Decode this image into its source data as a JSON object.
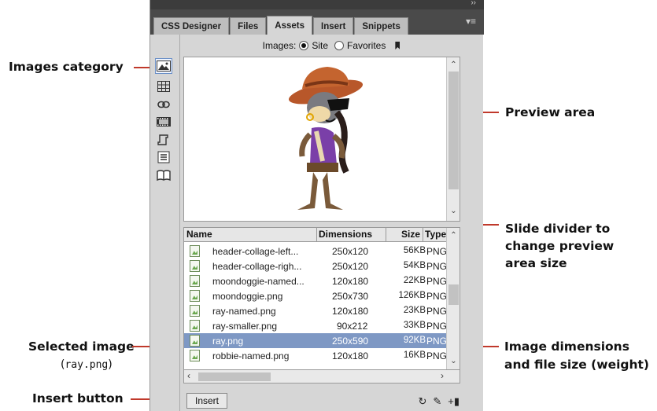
{
  "panel": {
    "tabs": [
      {
        "label": "CSS Designer"
      },
      {
        "label": "Files"
      },
      {
        "label": "Assets"
      },
      {
        "label": "Insert"
      },
      {
        "label": "Snippets"
      }
    ],
    "active_tab": "Assets",
    "filter": {
      "label": "Images:",
      "site_label": "Site",
      "favorites_label": "Favorites",
      "selected": "Site"
    },
    "categories": [
      "images-icon",
      "colors-icon",
      "urls-icon",
      "media-icon",
      "scripts-icon",
      "templates-icon",
      "library-icon"
    ],
    "table": {
      "headers": {
        "name": "Name",
        "dimensions": "Dimensions",
        "size": "Size",
        "type": "Type"
      },
      "rows": [
        {
          "name": "header-collage-left...",
          "dimensions": "250x120",
          "size": "56KB",
          "type": "PNG ..."
        },
        {
          "name": "header-collage-righ...",
          "dimensions": "250x120",
          "size": "54KB",
          "type": "PNG ..."
        },
        {
          "name": "moondoggie-named...",
          "dimensions": "120x180",
          "size": "22KB",
          "type": "PNG ..."
        },
        {
          "name": "moondoggie.png",
          "dimensions": "250x730",
          "size": "126KB",
          "type": "PNG ..."
        },
        {
          "name": "ray-named.png",
          "dimensions": "120x180",
          "size": "23KB",
          "type": "PNG ..."
        },
        {
          "name": "ray-smaller.png",
          "dimensions": "90x212",
          "size": "33KB",
          "type": "PNG ..."
        },
        {
          "name": "ray.png",
          "dimensions": "250x590",
          "size": "92KB",
          "type": "PNG ...",
          "selected": true
        },
        {
          "name": "robbie-named.png",
          "dimensions": "120x180",
          "size": "16KB",
          "type": "PNG ..."
        }
      ]
    },
    "insert_label": "Insert"
  },
  "callouts": {
    "images_category": "Images category",
    "preview_area": "Preview area",
    "slide_divider_1": "Slide divider to",
    "slide_divider_2": "change preview",
    "slide_divider_3": "area size",
    "selected_image": "Selected image",
    "selected_image_sub_open": "(",
    "selected_image_sub_file": "ray.png",
    "selected_image_sub_close": ")",
    "image_dims_1": "Image dimensions",
    "image_dims_2": "and file size (weight)",
    "insert_button": "Insert button"
  },
  "colors": {
    "callout_line": "#c0392b",
    "selection": "#7e98c4"
  }
}
